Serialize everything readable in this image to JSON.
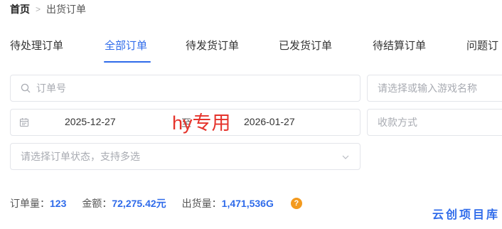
{
  "breadcrumb": {
    "home": "首页",
    "separator": ">",
    "current": "出货订单"
  },
  "tabs": [
    {
      "label": "待处理订单"
    },
    {
      "label": "全部订单"
    },
    {
      "label": "待发货订单"
    },
    {
      "label": "已发货订单"
    },
    {
      "label": "待结算订单"
    },
    {
      "label": "问题订"
    }
  ],
  "active_tab": "全部订单",
  "filters": {
    "order_search_placeholder": "订单号",
    "game_placeholder": "请选择或输入游戏名称",
    "date_start": "2025-12-27",
    "date_separator": "至",
    "date_end": "2026-01-27",
    "payment_placeholder": "收款方式",
    "status_placeholder": "请选择订单状态，支持多选"
  },
  "watermark": "hy专用",
  "summary": {
    "order_count_label": "订单量：",
    "order_count": "123",
    "amount_label": "金额：",
    "amount": "72,275.42元",
    "shipped_label": "出货量：",
    "shipped": "1,471,536G",
    "help": "?"
  },
  "brand": "云创项目库",
  "colors": {
    "accent": "#2f6bea",
    "watermark": "#e5332b",
    "help": "#f39a1e"
  },
  "icons": {
    "search": "search-icon",
    "calendar": "calendar-icon",
    "dropdown": "chevron-down-icon",
    "help": "help-icon"
  }
}
